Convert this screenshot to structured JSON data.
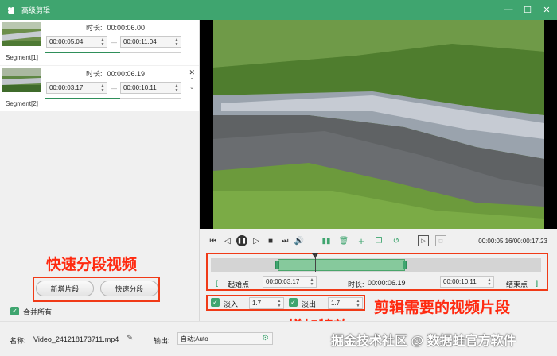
{
  "app": {
    "title": "高级剪辑"
  },
  "segments": [
    {
      "label": "Segment[1]",
      "duration_label": "时长:",
      "duration": "00:00:06.00",
      "start": "00:00:05.04",
      "end": "00:00:11.04",
      "progress": 0.55
    },
    {
      "label": "Segment[2]",
      "duration_label": "时长:",
      "duration": "00:00:06.19",
      "start": "00:00:03.17",
      "end": "00:00:10.11",
      "progress": 0.55
    }
  ],
  "left_buttons": {
    "add_segment": "新增片段",
    "quick_split": "快速分段"
  },
  "merge_all": {
    "label": "合并所有",
    "checked": true
  },
  "annotations": {
    "quick_split": "快速分段视频",
    "effects": "增加特效",
    "clip_needed": "剪辑需要的视频片段"
  },
  "player": {
    "timecode": "00:00:05.16/00:00:17.23",
    "playhead_fraction": 0.32
  },
  "trim": {
    "start_label": "起始点",
    "start_value": "00:00:03.17",
    "duration_label": "时长:",
    "duration_value": "00:00:06.19",
    "end_value": "00:00:10.11",
    "end_label": "结束点"
  },
  "effects": {
    "fade_in_label": "淡入",
    "fade_in_value": "1.7",
    "fade_out_label": "淡出",
    "fade_out_value": "1.7"
  },
  "bottom": {
    "name_label": "名称:",
    "name_value": "Video_241218173711.mp4",
    "output_label": "输出:",
    "output_value": "自动;Auto",
    "watermark": "掘金技术社区 @ 数据蛙官方软件"
  },
  "colors": {
    "accent": "#3fa56f",
    "annotation": "#f03a17"
  }
}
